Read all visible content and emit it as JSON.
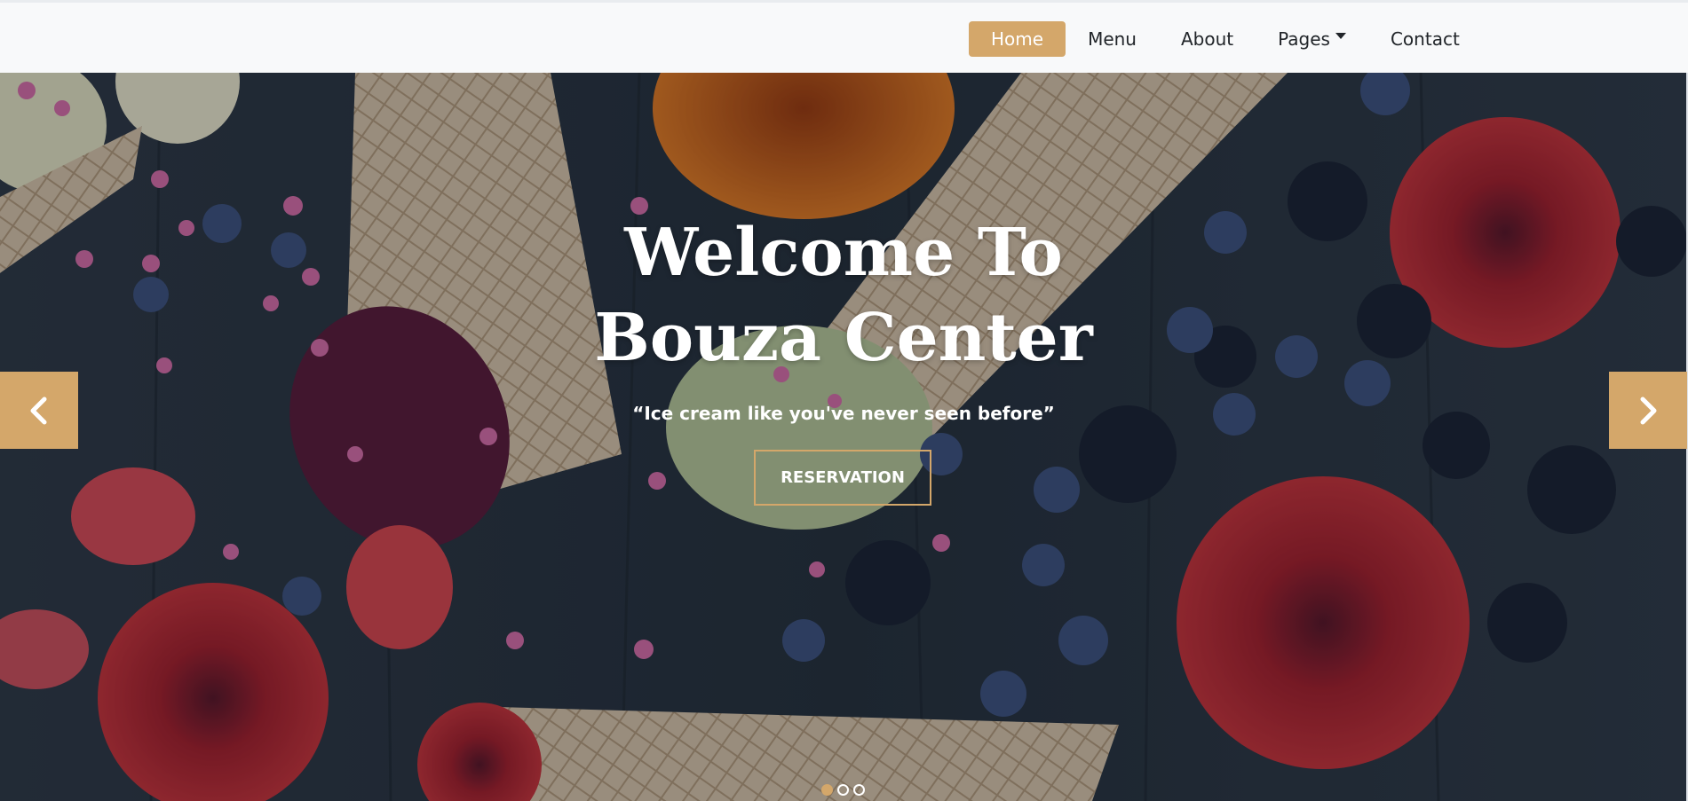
{
  "nav": {
    "items": [
      {
        "label": "Home",
        "active": true
      },
      {
        "label": "Menu",
        "active": false
      },
      {
        "label": "About",
        "active": false
      },
      {
        "label": "Pages",
        "active": false,
        "dropdown": true
      },
      {
        "label": "Contact",
        "active": false
      }
    ]
  },
  "hero": {
    "title_line1": "Welcome To",
    "title_line2": "Bouza Center",
    "tagline": "“Ice cream like you've never seen before”",
    "button_label": "RESERVATION",
    "slide_count": 3,
    "active_slide": 1
  },
  "icons": {
    "prev": "chevron-left-icon",
    "next": "chevron-right-icon",
    "dropdown": "caret-down-icon"
  },
  "colors": {
    "accent": "#d4a76a",
    "navbar_bg": "#f8f9fa",
    "nav_text": "#212529",
    "hero_text": "#ffffff"
  }
}
